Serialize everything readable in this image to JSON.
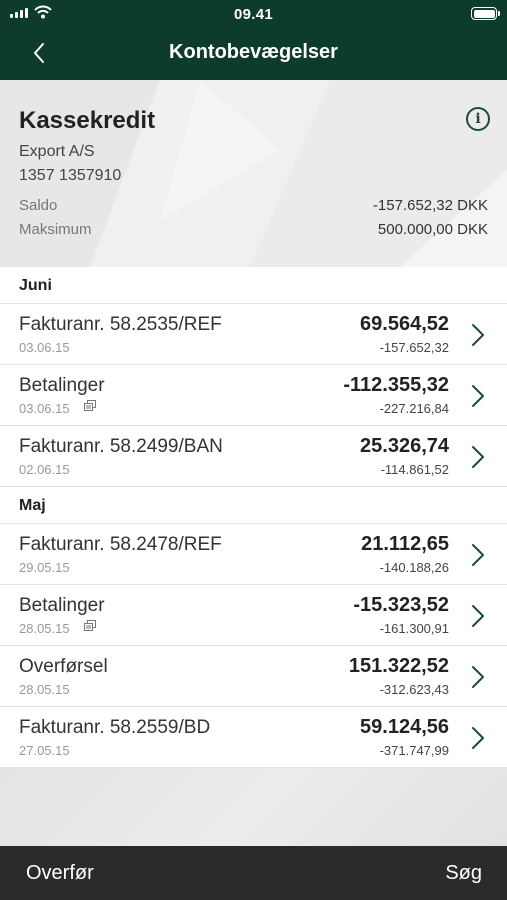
{
  "status_bar": {
    "time": "09.41"
  },
  "nav": {
    "title": "Kontobevægelser"
  },
  "account": {
    "name": "Kassekredit",
    "company": "Export A/S",
    "number": "1357 1357910",
    "saldo_label": "Saldo",
    "saldo_value": "-157.652,32 DKK",
    "maks_label": "Maksimum",
    "maks_value": "500.000,00 DKK"
  },
  "sections": [
    {
      "title": "Juni",
      "rows": [
        {
          "desc": "Fakturanr. 58.2535/REF",
          "date": "03.06.15",
          "amount": "69.564,52",
          "balance": "-157.652,32"
        },
        {
          "desc": "Betalinger",
          "date": "03.06.15",
          "amount": "-112.355,32",
          "balance": "-227.216,84"
        },
        {
          "desc": "Fakturanr. 58.2499/BAN",
          "date": "02.06.15",
          "amount": "25.326,74",
          "balance": "-114.861,52"
        }
      ]
    },
    {
      "title": "Maj",
      "rows": [
        {
          "desc": "Fakturanr. 58.2478/REF",
          "date": "29.05.15",
          "amount": "21.112,65",
          "balance": "-140.188,26"
        },
        {
          "desc": "Betalinger",
          "date": "28.05.15",
          "amount": "-15.323,52",
          "balance": "-161.300,91"
        },
        {
          "desc": "Overførsel",
          "date": "28.05.15",
          "amount": "151.322,52",
          "balance": "-312.623,43"
        },
        {
          "desc": "Fakturanr. 58.2559/BD",
          "date": "27.05.15",
          "amount": "59.124,56",
          "balance": "-371.747,99"
        }
      ]
    }
  ],
  "tabbar": {
    "left": "Overfør",
    "right": "Søg"
  },
  "colors": {
    "header": "#0d3b2c",
    "tabbar": "#2b2b2b",
    "accent": "#1c4b3a"
  },
  "icons": [
    "back-chevron-icon",
    "info-icon",
    "chevron-right-icon",
    "copy-icon",
    "signal-icon",
    "wifi-icon",
    "battery-icon"
  ]
}
